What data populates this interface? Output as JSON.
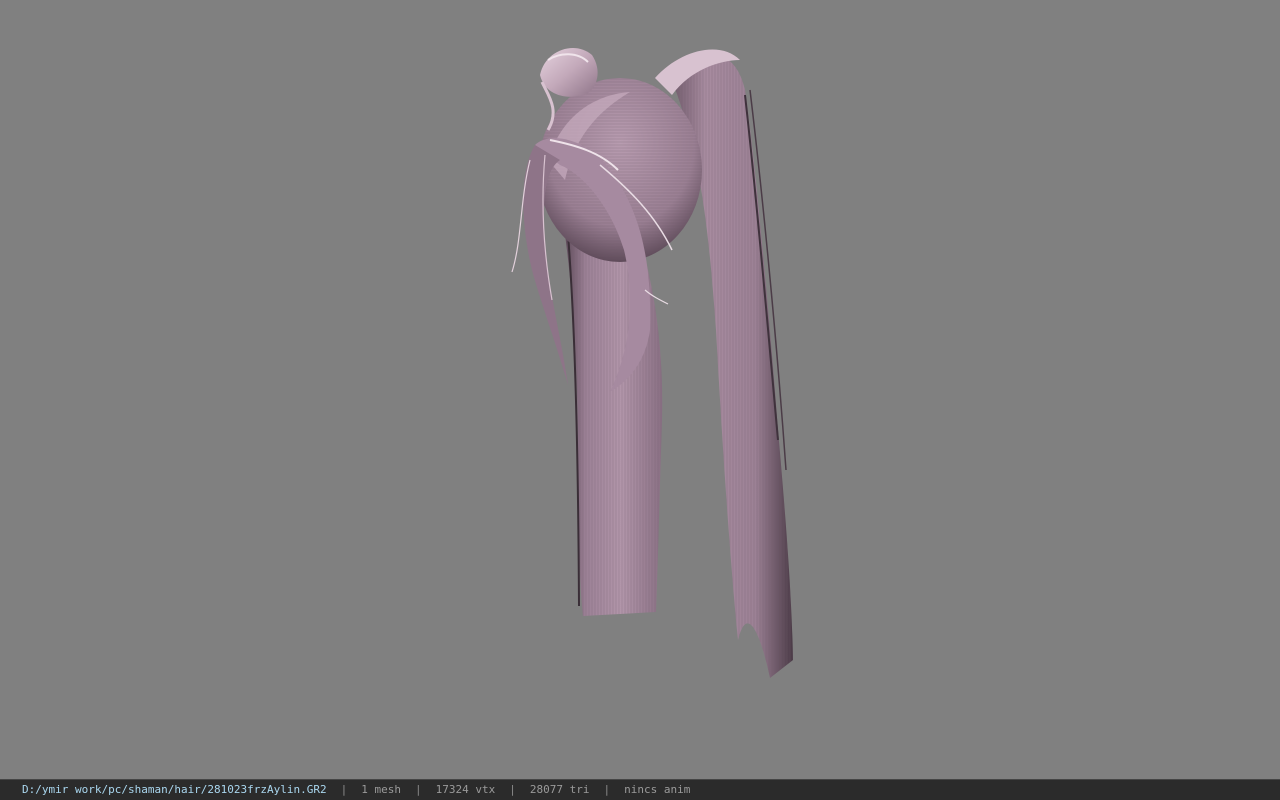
{
  "viewport": {
    "background_color": "#808080",
    "model": {
      "name": "hair-mesh",
      "hair_color": "#a2879b",
      "highlight_color": "#dcc6d4",
      "shadow_color": "#5e4a59"
    }
  },
  "status_bar": {
    "file_path": "D:/ymir work/pc/shaman/hair/281023frzAylin.GR2",
    "mesh_count": "1 mesh",
    "vertex_count": "17324 vtx",
    "triangle_count": "28077 tri",
    "anim_status": "nincs anim",
    "separator": "|"
  }
}
